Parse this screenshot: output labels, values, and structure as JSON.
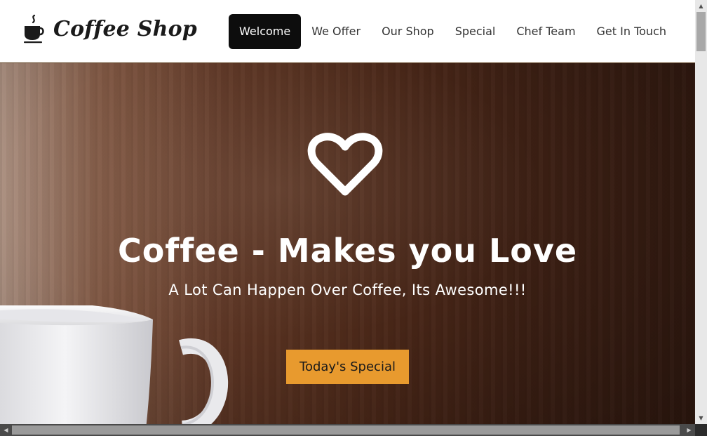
{
  "header": {
    "brand_name": "Coffee Shop",
    "brand_icon": "coffee-cup-icon"
  },
  "nav": {
    "items": [
      {
        "label": "Welcome",
        "active": true
      },
      {
        "label": "We Offer",
        "active": false
      },
      {
        "label": "Our Shop",
        "active": false
      },
      {
        "label": "Special",
        "active": false
      },
      {
        "label": "Chef Team",
        "active": false
      },
      {
        "label": "Get In Touch",
        "active": false
      }
    ]
  },
  "hero": {
    "icon": "heart-icon",
    "title": "Coffee - Makes you Love",
    "subtitle": "A Lot Can Happen Over Coffee, Its Awesome!!!",
    "cta_label": "Today's Special"
  },
  "colors": {
    "accent": "#e89a2e",
    "nav_active_bg": "#0d0d0d",
    "hero_text": "#ffffff"
  }
}
